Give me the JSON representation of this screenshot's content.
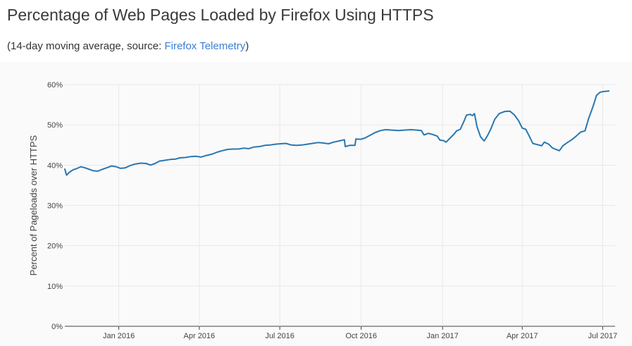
{
  "header": {
    "title": "Percentage of Web Pages Loaded by Firefox Using HTTPS",
    "subtitle_prefix": "(14-day moving average, source: ",
    "subtitle_link": "Firefox Telemetry",
    "subtitle_suffix": ")"
  },
  "colors": {
    "line": "#2a77b1",
    "grid": "#e8e8e8",
    "link": "#3a7fd2"
  },
  "chart_data": {
    "type": "line",
    "title": "",
    "xlabel": "",
    "ylabel": "Percent of Pageloads over HTTPS",
    "ylim": [
      0,
      60
    ],
    "xlim": [
      "2015-11-01",
      "2017-07-15"
    ],
    "grid": true,
    "y_ticks": [
      {
        "value": 0,
        "label": "0%"
      },
      {
        "value": 10,
        "label": "10%"
      },
      {
        "value": 20,
        "label": "20%"
      },
      {
        "value": 30,
        "label": "30%"
      },
      {
        "value": 40,
        "label": "40%"
      },
      {
        "value": 50,
        "label": "50%"
      },
      {
        "value": 60,
        "label": "60%"
      }
    ],
    "x_ticks": [
      {
        "date": "2016-01-01",
        "label": "Jan 2016"
      },
      {
        "date": "2016-04-01",
        "label": "Apr 2016"
      },
      {
        "date": "2016-07-01",
        "label": "Jul 2016"
      },
      {
        "date": "2016-10-01",
        "label": "Oct 2016"
      },
      {
        "date": "2017-01-01",
        "label": "Jan 2017"
      },
      {
        "date": "2017-04-01",
        "label": "Apr 2017"
      },
      {
        "date": "2017-07-01",
        "label": "Jul 2017"
      }
    ],
    "series": [
      {
        "name": "",
        "points": [
          [
            "2015-11-01",
            39.0
          ],
          [
            "2015-11-03",
            37.5
          ],
          [
            "2015-11-06",
            38.2
          ],
          [
            "2015-11-10",
            38.8
          ],
          [
            "2015-11-15",
            39.2
          ],
          [
            "2015-11-19",
            39.6
          ],
          [
            "2015-11-23",
            39.4
          ],
          [
            "2015-11-28",
            39.0
          ],
          [
            "2015-12-03",
            38.6
          ],
          [
            "2015-12-08",
            38.5
          ],
          [
            "2015-12-14",
            39.0
          ],
          [
            "2015-12-19",
            39.4
          ],
          [
            "2015-12-24",
            39.8
          ],
          [
            "2015-12-29",
            39.6
          ],
          [
            "2016-01-03",
            39.2
          ],
          [
            "2016-01-08",
            39.3
          ],
          [
            "2016-01-14",
            39.9
          ],
          [
            "2016-01-20",
            40.3
          ],
          [
            "2016-01-26",
            40.5
          ],
          [
            "2016-02-01",
            40.4
          ],
          [
            "2016-02-06",
            40.0
          ],
          [
            "2016-02-11",
            40.4
          ],
          [
            "2016-02-16",
            41.0
          ],
          [
            "2016-02-22",
            41.2
          ],
          [
            "2016-02-28",
            41.4
          ],
          [
            "2016-03-05",
            41.5
          ],
          [
            "2016-03-10",
            41.8
          ],
          [
            "2016-03-16",
            41.9
          ],
          [
            "2016-03-22",
            42.1
          ],
          [
            "2016-03-28",
            42.2
          ],
          [
            "2016-04-03",
            42.0
          ],
          [
            "2016-04-09",
            42.4
          ],
          [
            "2016-04-15",
            42.7
          ],
          [
            "2016-04-21",
            43.2
          ],
          [
            "2016-04-27",
            43.6
          ],
          [
            "2016-05-03",
            43.9
          ],
          [
            "2016-05-09",
            44.0
          ],
          [
            "2016-05-15",
            44.0
          ],
          [
            "2016-05-21",
            44.2
          ],
          [
            "2016-05-27",
            44.1
          ],
          [
            "2016-06-02",
            44.5
          ],
          [
            "2016-06-08",
            44.6
          ],
          [
            "2016-06-14",
            44.9
          ],
          [
            "2016-06-20",
            45.0
          ],
          [
            "2016-06-26",
            45.2
          ],
          [
            "2016-07-02",
            45.3
          ],
          [
            "2016-07-08",
            45.4
          ],
          [
            "2016-07-14",
            45.0
          ],
          [
            "2016-07-20",
            44.9
          ],
          [
            "2016-07-26",
            45.0
          ],
          [
            "2016-08-01",
            45.2
          ],
          [
            "2016-08-07",
            45.4
          ],
          [
            "2016-08-13",
            45.6
          ],
          [
            "2016-08-19",
            45.5
          ],
          [
            "2016-08-25",
            45.3
          ],
          [
            "2016-08-31",
            45.7
          ],
          [
            "2016-09-06",
            46.0
          ],
          [
            "2016-09-12",
            46.3
          ],
          [
            "2016-09-13",
            44.6
          ],
          [
            "2016-09-18",
            44.9
          ],
          [
            "2016-09-24",
            44.9
          ],
          [
            "2016-09-25",
            46.5
          ],
          [
            "2016-09-30",
            46.4
          ],
          [
            "2016-10-05",
            46.7
          ],
          [
            "2016-10-11",
            47.4
          ],
          [
            "2016-10-17",
            48.1
          ],
          [
            "2016-10-23",
            48.6
          ],
          [
            "2016-10-29",
            48.8
          ],
          [
            "2016-11-05",
            48.7
          ],
          [
            "2016-11-12",
            48.6
          ],
          [
            "2016-11-19",
            48.7
          ],
          [
            "2016-11-26",
            48.8
          ],
          [
            "2016-12-03",
            48.7
          ],
          [
            "2016-12-08",
            48.6
          ],
          [
            "2016-12-11",
            47.5
          ],
          [
            "2016-12-16",
            47.9
          ],
          [
            "2016-12-21",
            47.6
          ],
          [
            "2016-12-26",
            47.2
          ],
          [
            "2016-12-29",
            46.2
          ],
          [
            "2017-01-02",
            46.1
          ],
          [
            "2017-01-05",
            45.7
          ],
          [
            "2017-01-09",
            46.6
          ],
          [
            "2017-01-13",
            47.5
          ],
          [
            "2017-01-17",
            48.5
          ],
          [
            "2017-01-21",
            48.9
          ],
          [
            "2017-01-25",
            50.8
          ],
          [
            "2017-01-28",
            52.4
          ],
          [
            "2017-02-01",
            52.6
          ],
          [
            "2017-02-04",
            52.3
          ],
          [
            "2017-02-06",
            52.8
          ],
          [
            "2017-02-09",
            49.5
          ],
          [
            "2017-02-13",
            47.0
          ],
          [
            "2017-02-17",
            46.0
          ],
          [
            "2017-02-21",
            47.4
          ],
          [
            "2017-02-25",
            49.2
          ],
          [
            "2017-03-01",
            51.4
          ],
          [
            "2017-03-06",
            52.8
          ],
          [
            "2017-03-12",
            53.3
          ],
          [
            "2017-03-18",
            53.4
          ],
          [
            "2017-03-23",
            52.5
          ],
          [
            "2017-03-28",
            51.0
          ],
          [
            "2017-04-01",
            49.2
          ],
          [
            "2017-04-05",
            48.9
          ],
          [
            "2017-04-09",
            47.2
          ],
          [
            "2017-04-13",
            45.4
          ],
          [
            "2017-04-18",
            45.1
          ],
          [
            "2017-04-23",
            44.8
          ],
          [
            "2017-04-26",
            45.7
          ],
          [
            "2017-05-01",
            45.2
          ],
          [
            "2017-05-05",
            44.3
          ],
          [
            "2017-05-09",
            43.9
          ],
          [
            "2017-05-13",
            43.6
          ],
          [
            "2017-05-17",
            44.8
          ],
          [
            "2017-05-22",
            45.6
          ],
          [
            "2017-05-27",
            46.3
          ],
          [
            "2017-06-01",
            47.2
          ],
          [
            "2017-06-06",
            48.2
          ],
          [
            "2017-06-11",
            48.5
          ],
          [
            "2017-06-15",
            51.5
          ],
          [
            "2017-06-20",
            54.5
          ],
          [
            "2017-06-24",
            57.3
          ],
          [
            "2017-06-28",
            58.1
          ],
          [
            "2017-07-03",
            58.3
          ],
          [
            "2017-07-08",
            58.4
          ]
        ]
      }
    ]
  }
}
